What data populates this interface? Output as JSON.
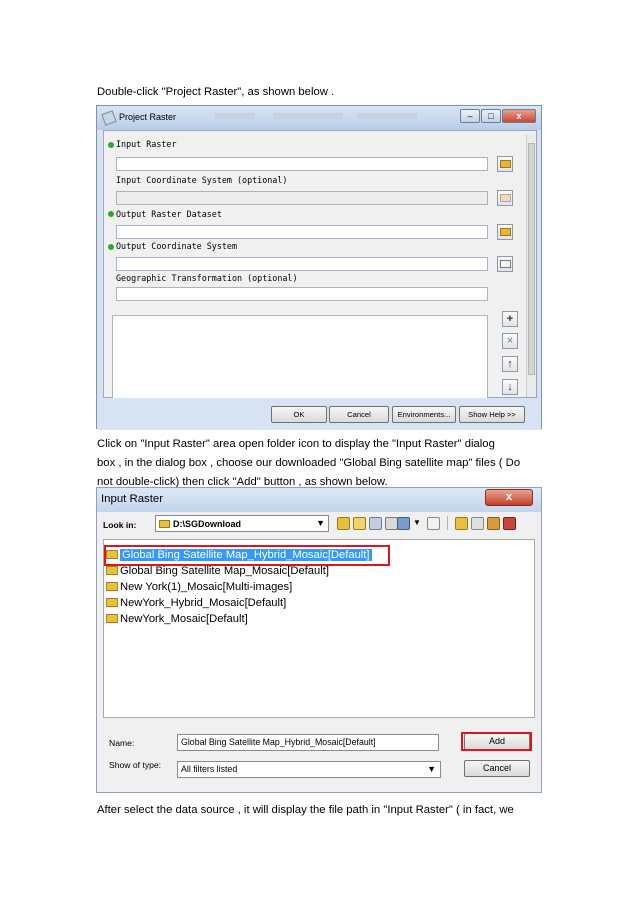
{
  "intro": "Double-click \"Project Raster\", as shown below .",
  "step2_line1": "Click on \"Input Raster\" area open folder icon to display the \"Input Raster\" dialog",
  "step2_line2": "box , in the dialog box , choose our downloaded \"Global Bing satellite map\" files ( Do",
  "step2_line3": "not double-click) then click \"Add\" button , as shown below.",
  "step3": "After select the data source , it will display the file path in \"Input Raster\" ( in fact, we",
  "project_raster": {
    "title": "Project Raster",
    "fields": [
      {
        "label": "Input Raster",
        "required": true
      },
      {
        "label": "Input Coordinate System (optional)",
        "required": false
      },
      {
        "label": "Output Raster Dataset",
        "required": true
      },
      {
        "label": "Output Coordinate System",
        "required": true
      },
      {
        "label": "Geographic Transformation (optional)",
        "required": false
      }
    ],
    "side_buttons": [
      "+",
      "×",
      "↑",
      "↓"
    ],
    "buttons": {
      "ok": "OK",
      "cancel": "Cancel",
      "environments": "Environments...",
      "help": "Show Help >>"
    },
    "window_controls": {
      "minimize": "–",
      "maximize": "□",
      "close": "x"
    }
  },
  "input_raster_dialog": {
    "title": "Input Raster",
    "close": "x",
    "look_in_label": "Look in:",
    "look_in_value": "D:\\SGDownload",
    "items": [
      "Global Bing Satellite Map_Hybrid_Mosaic[Default]",
      "Global Bing Satellite Map_Mosaic[Default]",
      "New York(1)_Mosaic[Multi-images]",
      "NewYork_Hybrid_Mosaic[Default]",
      "NewYork_Mosaic[Default]"
    ],
    "selected_index": 0,
    "name_label": "Name:",
    "name_value": "Global Bing Satellite Map_Hybrid_Mosaic[Default]",
    "type_label": "Show of type:",
    "type_value": "All filters listed",
    "add_label": "Add",
    "cancel_label": "Cancel"
  }
}
